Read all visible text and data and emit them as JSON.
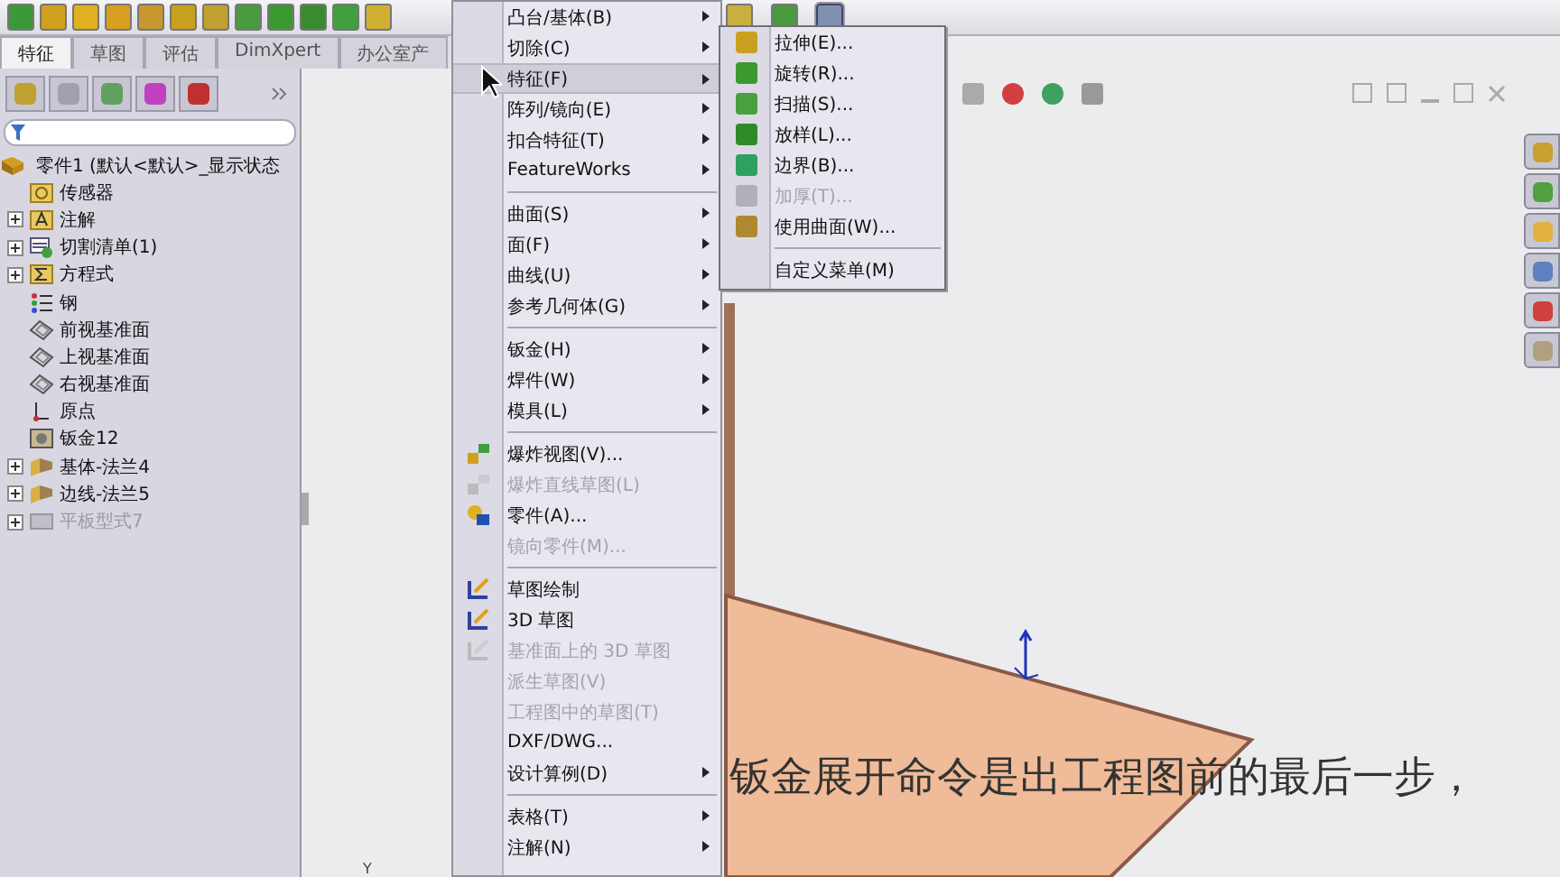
{
  "tabs": [
    {
      "label": "特征",
      "selected": true
    },
    {
      "label": "草图",
      "selected": false
    },
    {
      "label": "评估",
      "selected": false
    },
    {
      "label": "DimXpert",
      "selected": false
    },
    {
      "label": "办公室产",
      "selected": false
    }
  ],
  "feature_tree": {
    "root": "零件1  (默认<默认>_显示状态",
    "items": [
      {
        "label": "传感器",
        "kind": "sensor",
        "expandable": false,
        "disabled": false
      },
      {
        "label": "注解",
        "kind": "annotation",
        "expandable": true,
        "disabled": false
      },
      {
        "label": "切割清单(1)",
        "kind": "cutlist",
        "expandable": true,
        "disabled": false
      },
      {
        "label": "方程式",
        "kind": "equation",
        "expandable": true,
        "disabled": false
      },
      {
        "label": "钢",
        "kind": "material",
        "expandable": false,
        "disabled": false
      },
      {
        "label": "前视基准面",
        "kind": "plane",
        "expandable": false,
        "disabled": false
      },
      {
        "label": "上视基准面",
        "kind": "plane",
        "expandable": false,
        "disabled": false
      },
      {
        "label": "右视基准面",
        "kind": "plane",
        "expandable": false,
        "disabled": false
      },
      {
        "label": "原点",
        "kind": "origin",
        "expandable": false,
        "disabled": false
      },
      {
        "label": "钣金12",
        "kind": "sheetmetal",
        "expandable": false,
        "disabled": false
      },
      {
        "label": "基体-法兰4",
        "kind": "flange",
        "expandable": true,
        "disabled": false
      },
      {
        "label": "边线-法兰5",
        "kind": "flange",
        "expandable": true,
        "disabled": false
      },
      {
        "label": "平板型式7",
        "kind": "flat",
        "expandable": true,
        "disabled": true
      }
    ]
  },
  "menu": {
    "groups": [
      [
        {
          "label": "凸台/基体(B)",
          "kind": "plain",
          "submenu": true,
          "disabled": false,
          "selected": false
        },
        {
          "label": "切除(C)",
          "kind": "plain",
          "submenu": true,
          "disabled": false,
          "selected": false
        },
        {
          "label": "特征(F)",
          "kind": "plain",
          "submenu": true,
          "disabled": false,
          "selected": true
        },
        {
          "label": "阵列/镜向(E)",
          "kind": "plain",
          "submenu": true,
          "disabled": false,
          "selected": false
        },
        {
          "label": "扣合特征(T)",
          "kind": "plain",
          "submenu": true,
          "disabled": false,
          "selected": false
        },
        {
          "label": "FeatureWorks",
          "kind": "plain",
          "submenu": true,
          "disabled": false,
          "selected": false
        }
      ],
      [
        {
          "label": "曲面(S)",
          "kind": "plain",
          "submenu": true,
          "disabled": false,
          "selected": false
        },
        {
          "label": "面(F)",
          "kind": "plain",
          "submenu": true,
          "disabled": false,
          "selected": false
        },
        {
          "label": "曲线(U)",
          "kind": "plain",
          "submenu": true,
          "disabled": false,
          "selected": false
        },
        {
          "label": "参考几何体(G)",
          "kind": "plain",
          "submenu": true,
          "disabled": false,
          "selected": false
        }
      ],
      [
        {
          "label": "钣金(H)",
          "kind": "plain",
          "submenu": true,
          "disabled": false,
          "selected": false
        },
        {
          "label": "焊件(W)",
          "kind": "plain",
          "submenu": true,
          "disabled": false,
          "selected": false
        },
        {
          "label": "模具(L)",
          "kind": "plain",
          "submenu": true,
          "disabled": false,
          "selected": false
        }
      ],
      [
        {
          "label": "爆炸视图(V)...",
          "kind": "explode",
          "submenu": false,
          "disabled": false,
          "selected": false
        },
        {
          "label": "爆炸直线草图(L)",
          "kind": "explode",
          "submenu": false,
          "disabled": true,
          "selected": false
        },
        {
          "label": "零件(A)...",
          "kind": "part",
          "submenu": false,
          "disabled": false,
          "selected": false
        },
        {
          "label": "镜向零件(M)...",
          "kind": "plain",
          "submenu": false,
          "disabled": true,
          "selected": false
        }
      ],
      [
        {
          "label": "草图绘制",
          "kind": "sketch",
          "submenu": false,
          "disabled": false,
          "selected": false
        },
        {
          "label": "3D 草图",
          "kind": "sketch",
          "submenu": false,
          "disabled": false,
          "selected": false
        },
        {
          "label": "基准面上的 3D 草图",
          "kind": "sketch",
          "submenu": false,
          "disabled": true,
          "selected": false
        },
        {
          "label": "派生草图(V)",
          "kind": "plain",
          "submenu": false,
          "disabled": true,
          "selected": false
        },
        {
          "label": "工程图中的草图(T)",
          "kind": "plain",
          "submenu": false,
          "disabled": true,
          "selected": false
        },
        {
          "label": "DXF/DWG...",
          "kind": "plain",
          "submenu": false,
          "disabled": false,
          "selected": false
        },
        {
          "label": "设计算例(D)",
          "kind": "plain",
          "submenu": true,
          "disabled": false,
          "selected": false
        }
      ],
      [
        {
          "label": "表格(T)",
          "kind": "plain",
          "submenu": true,
          "disabled": false,
          "selected": false
        },
        {
          "label": "注解(N)",
          "kind": "plain",
          "submenu": true,
          "disabled": false,
          "selected": false
        }
      ]
    ]
  },
  "submenu": {
    "groups": [
      [
        {
          "label": "拉伸(E)...",
          "color": "#c9a020",
          "disabled": false
        },
        {
          "label": "旋转(R)...",
          "color": "#3a9a30",
          "disabled": false
        },
        {
          "label": "扫描(S)...",
          "color": "#4aa040",
          "disabled": false
        },
        {
          "label": "放样(L)...",
          "color": "#2f8a2a",
          "disabled": false
        },
        {
          "label": "边界(B)...",
          "color": "#30a060",
          "disabled": false
        },
        {
          "label": "加厚(T)...",
          "color": "#b0b0b8",
          "disabled": true
        },
        {
          "label": "使用曲面(W)...",
          "color": "#b08830",
          "disabled": false
        }
      ],
      [
        {
          "label": "自定义菜单(M)",
          "disabled": false
        }
      ]
    ]
  },
  "axis_label": "Y",
  "subtitle": "钣金展开命令是出工程图前的最后一步，"
}
